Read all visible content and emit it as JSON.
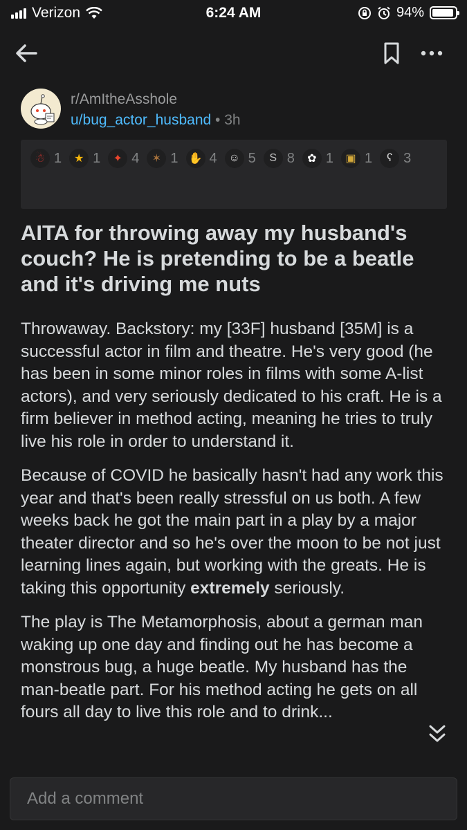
{
  "status": {
    "carrier": "Verizon",
    "time": "6:24 AM",
    "battery": "94%",
    "battery_level": 0.94
  },
  "nav": {
    "back_icon": "back-arrow-icon",
    "bookmark_icon": "bookmark-icon",
    "more_icon": "more-options-icon"
  },
  "post": {
    "subreddit": "r/AmItheAsshole",
    "author": "u/bug_actor_husband",
    "separator": "•",
    "age": "3h",
    "title": "AITA for throwing away my husband's couch? He is pretending to be a beatle and it's driving me nuts",
    "paragraph1": "Throwaway. Backstory: my [33F] husband [35M] is a successful actor in film and theatre. He's very good (he has been in some minor roles in films with some A-list actors), and very seriously dedicated to his craft. He is a firm believer in method acting, meaning he tries to truly live his role in order to understand it.",
    "paragraph2_a": "Because of COVID he basically hasn't had any work this year and that's been really stressful on us both. A few weeks back he got the main part in a play by a major theater director and so he's over the moon to be not just learning lines again, but working with the greats. He is taking this opportunity ",
    "paragraph2_bold": "extremely",
    "paragraph2_b": " seriously.",
    "paragraph3": "The play is The Metamorphosis, about a german man waking up one day and finding out he has become a monstrous bug, a huge beatle. My husband has the man-beatle part. For his method acting he gets on all fours all day to live this role and to drink..."
  },
  "awards": [
    {
      "icon": "santa-award-icon",
      "count": "1",
      "color": "#c6342e",
      "glyph": "☃"
    },
    {
      "icon": "gold-award-icon",
      "count": "1",
      "color": "#f5b50a",
      "glyph": "★"
    },
    {
      "icon": "rocket-award-icon",
      "count": "4",
      "color": "#e8452c",
      "glyph": "✦"
    },
    {
      "icon": "reindeer-award-icon",
      "count": "1",
      "color": "#a6713b",
      "glyph": "✶"
    },
    {
      "icon": "handshake-award-icon",
      "count": "4",
      "color": "#b8b8b8",
      "glyph": "✋"
    },
    {
      "icon": "facepalm-award-icon",
      "count": "5",
      "color": "#d9d9d9",
      "glyph": "☺"
    },
    {
      "icon": "silver-award-icon",
      "count": "8",
      "color": "#c0c0c0",
      "glyph": "S"
    },
    {
      "icon": "wholesome-award-icon",
      "count": "1",
      "color": "#ffffff",
      "glyph": "✿"
    },
    {
      "icon": "framed-award-icon",
      "count": "1",
      "color": "#d4a93a",
      "glyph": "▣"
    },
    {
      "icon": "bear-award-icon",
      "count": "3",
      "color": "#e6e6e6",
      "glyph": "ʕ"
    }
  ],
  "comment": {
    "placeholder": "Add a comment"
  },
  "jump": {
    "icon": "double-chevron-down-icon"
  }
}
